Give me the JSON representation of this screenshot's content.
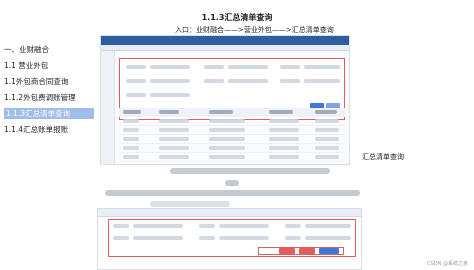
{
  "page": {
    "title": "1.1.3汇总清单查询",
    "entry_path": "入口：业财融合——>营业外包——>汇总清单查询"
  },
  "toc": {
    "items": [
      "一、业财融合",
      "1.1 营业外包",
      "1.1外包商合同查询",
      "1.1.2外包费调账管理",
      "1.1.3汇总清单查询",
      "1.1.4汇总账单报账"
    ],
    "active_index": 4
  },
  "side_caption": "汇总清单查询",
  "watermark": "CSDN @系统之家",
  "colors": {
    "accent": "#2f5e9e",
    "highlight_box": "#e85b5b",
    "toc_active": "#9fbde8",
    "button": "#3d7ad6"
  }
}
